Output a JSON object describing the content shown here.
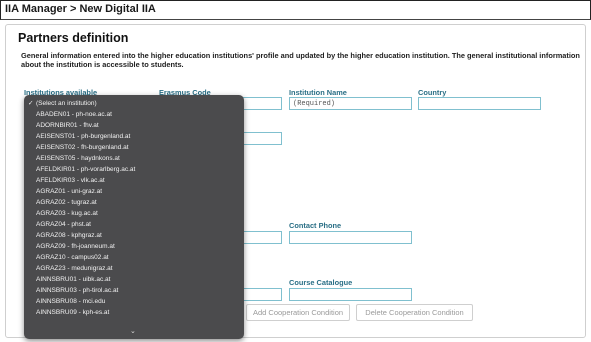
{
  "breadcrumb": "IIA Manager > New Digital IIA",
  "panel": {
    "title": "Partners definition",
    "info": "General information entered into the higher education institutions' profile and updated by the higher education institution. The general institutional information about the institution is accessible to students."
  },
  "form": {
    "institutions_available_label": "Institutions available",
    "erasmus_code_label": "Erasmus Code",
    "institution_name_label": "Institution Name",
    "institution_name_placeholder": "(Required)",
    "country_label": "Country",
    "contact_phone_label": "Contact Phone",
    "course_catalogue_label": "Course Catalogue"
  },
  "buttons": {
    "add_cooperation": "Add Cooperation Condition",
    "delete_cooperation": "Delete Cooperation Condition"
  },
  "dropdown": {
    "selected_label": "(Select an institution)",
    "options": [
      "(Select an institution)",
      "ABADEN01 - ph-noe.ac.at",
      "ADORNBIR01 - fhv.at",
      "AEISENST01 - ph-burgenland.at",
      "AEISENST02 - fh-burgenland.at",
      "AEISENST05 - haydnkons.at",
      "AFELDKIR01 - ph-vorarlberg.ac.at",
      "AFELDKIR03 - vlk.ac.at",
      "AGRAZ01 - uni-graz.at",
      "AGRAZ02 - tugraz.at",
      "AGRAZ03 - kug.ac.at",
      "AGRAZ04 - phst.at",
      "AGRAZ08 - kphgraz.at",
      "AGRAZ09 - fh-joanneum.at",
      "AGRAZ10 - campus02.at",
      "AGRAZ23 - medunigraz.at",
      "AINNSBRU01 - uibk.ac.at",
      "AINNSBRU03 - ph-tirol.ac.at",
      "AINNSBRU08 - mci.edu",
      "AINNSBRU09 - kph-es.at"
    ]
  }
}
